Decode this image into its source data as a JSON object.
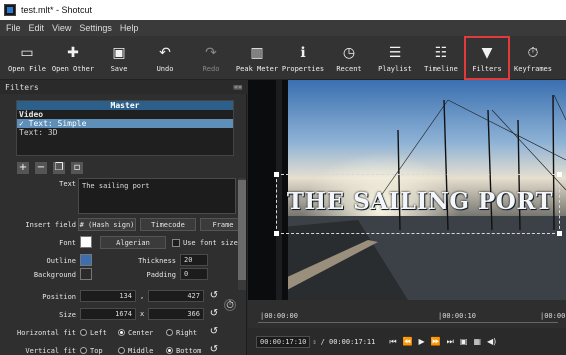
{
  "window": {
    "title": "test.mlt* - Shotcut"
  },
  "menu": [
    "File",
    "Edit",
    "View",
    "Settings",
    "Help"
  ],
  "toolbar": [
    {
      "label": "Open File",
      "icon": "folder-icon",
      "glyph": "▭"
    },
    {
      "label": "Open Other",
      "icon": "open-other-icon",
      "glyph": "✚"
    },
    {
      "label": "Save",
      "icon": "save-icon",
      "glyph": "▣"
    },
    {
      "label": "Undo",
      "icon": "undo-icon",
      "glyph": "↶"
    },
    {
      "label": "Redo",
      "icon": "redo-icon",
      "glyph": "↷"
    },
    {
      "label": "Peak Meter",
      "icon": "peak-meter-icon",
      "glyph": "▥"
    },
    {
      "label": "Properties",
      "icon": "info-icon",
      "glyph": "ℹ"
    },
    {
      "label": "Recent",
      "icon": "clock-icon",
      "glyph": "◷"
    },
    {
      "label": "Playlist",
      "icon": "list-icon",
      "glyph": "☰"
    },
    {
      "label": "Timeline",
      "icon": "timeline-icon",
      "glyph": "☷"
    },
    {
      "label": "Filters",
      "icon": "funnel-icon",
      "glyph": "▼"
    },
    {
      "label": "Keyframes",
      "icon": "stopwatch-icon",
      "glyph": "⏱"
    }
  ],
  "filters_panel": {
    "title": "Filters",
    "master": "Master",
    "group": "Video",
    "items": [
      "✓ Text: Simple",
      "Text: 3D"
    ]
  },
  "props": {
    "text_label": "Text",
    "text_value": "The sailing port",
    "insert_field_label": "Insert field",
    "hash_btn": "# (Hash sign)",
    "timecode_btn": "Timecode",
    "frame_btn": "Frame",
    "font_label": "Font",
    "font_value": "Algerian",
    "use_font_size": "Use font size",
    "outline_label": "Outline",
    "thickness_label": "Thickness",
    "thickness_value": "20",
    "background_label": "Background",
    "padding_label": "Padding",
    "padding_value": "0",
    "position_label": "Position",
    "pos_x": "134",
    "pos_y": "427",
    "size_label": "Size",
    "size_w": "1674",
    "size_h": "366",
    "hfit_label": "Horizontal fit",
    "hfit_options": [
      "Left",
      "Center",
      "Right"
    ],
    "vfit_label": "Vertical fit",
    "vfit_options": [
      "Top",
      "Middle",
      "Bottom"
    ],
    "comma": ",",
    "times": "x"
  },
  "viewer": {
    "overlay_text": "THE SAILING PORT"
  },
  "timeline": {
    "tick1": "|00:00:00",
    "tick2": "|00:00:10",
    "tick3": "|00:00",
    "current_tc": "00:00:17:10",
    "total_tc": "/ 00:00:17:11"
  },
  "colors": {
    "accent": "#2d7bd4",
    "filters_highlight": "#e23a3a",
    "selected_row": "#5d8fb8",
    "outline_color": "#3d6fb0",
    "font_swatch": "#ffffff"
  }
}
